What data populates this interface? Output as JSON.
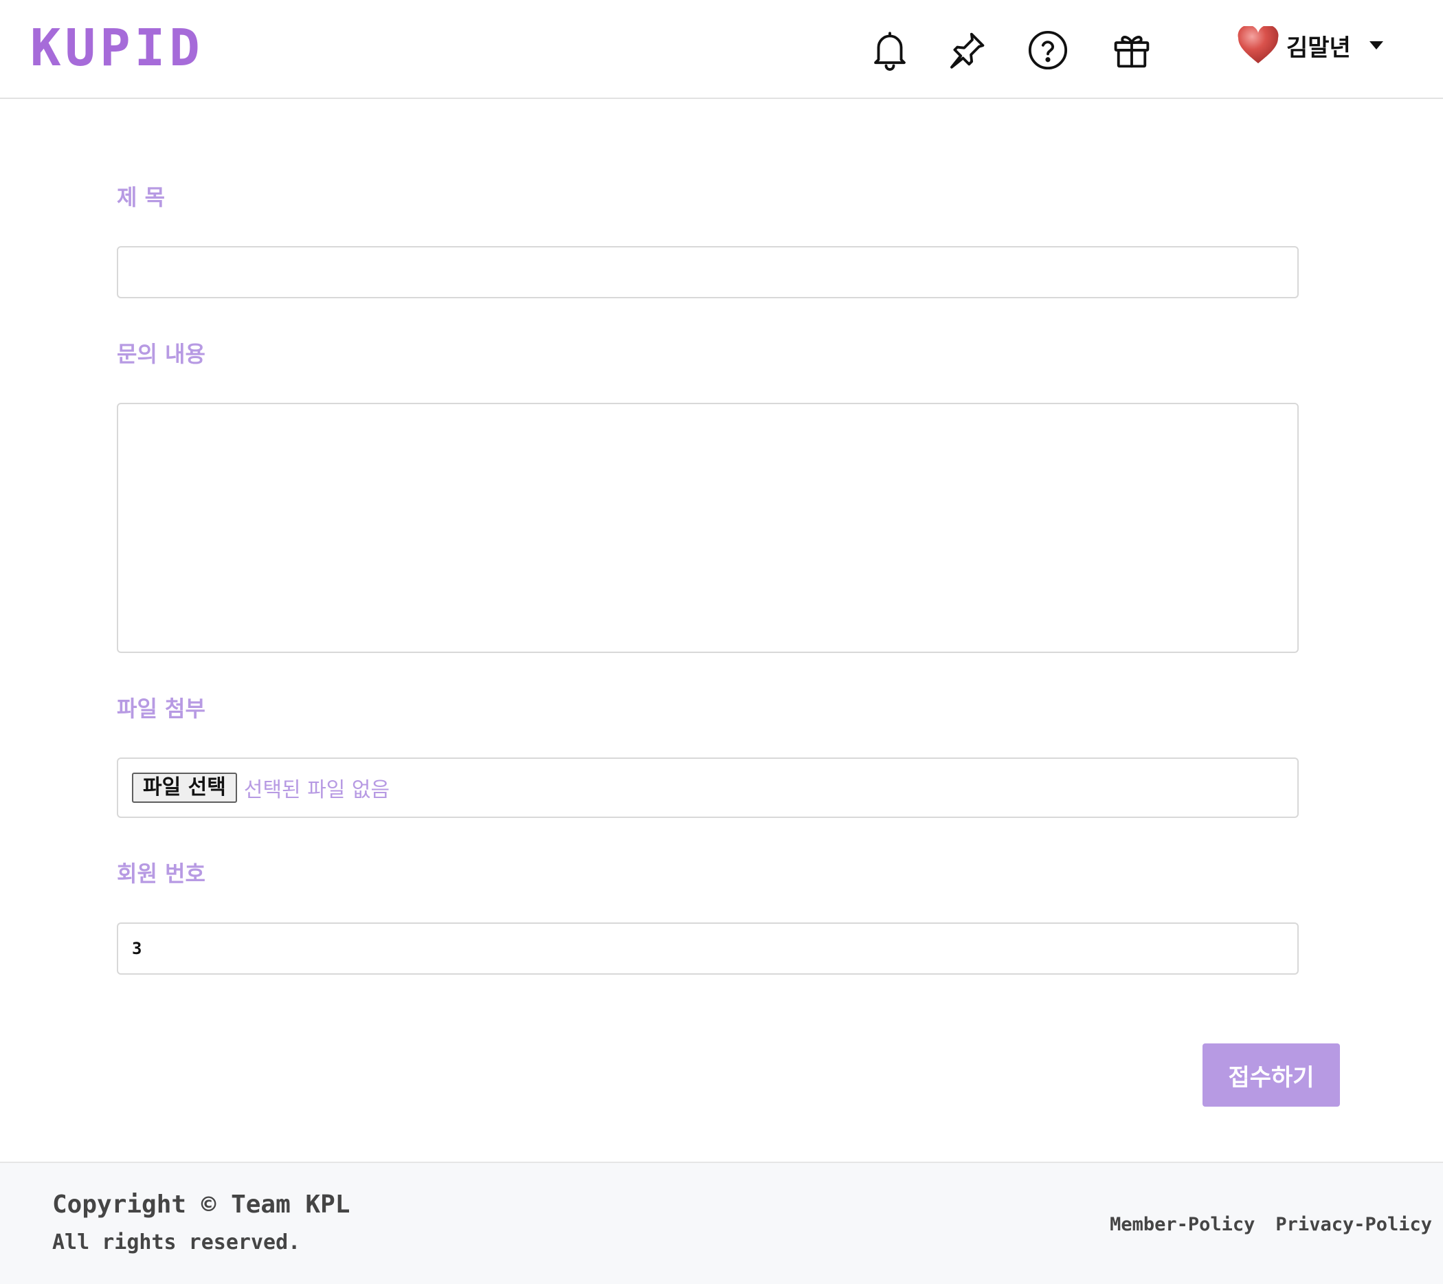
{
  "header": {
    "logo": "KUPID",
    "icons": [
      "bell-icon",
      "pin-icon",
      "help-circle-icon",
      "gift-icon"
    ],
    "user": {
      "avatar_icon": "heart-icon",
      "name": "김말년",
      "dropdown_icon": "caret-down-icon"
    }
  },
  "form": {
    "title_label": "제 목",
    "title_value": "",
    "content_label": "문의 내용",
    "content_value": "",
    "attachment_label": "파일 첨부",
    "file_button_label": "파일 선택",
    "file_status": "선택된 파일 없음",
    "member_label": "회원 번호",
    "member_value": "3",
    "submit_label": "접수하기"
  },
  "footer": {
    "copyright": "Copyright © Team KPL",
    "rights": "All rights reserved.",
    "links": [
      "Member-Policy",
      "Privacy-Policy"
    ]
  },
  "colors": {
    "brand": "#a66bd9",
    "label": "#b79ae3",
    "button": "#b79ae3",
    "footer_bg": "#f7f8fa"
  }
}
